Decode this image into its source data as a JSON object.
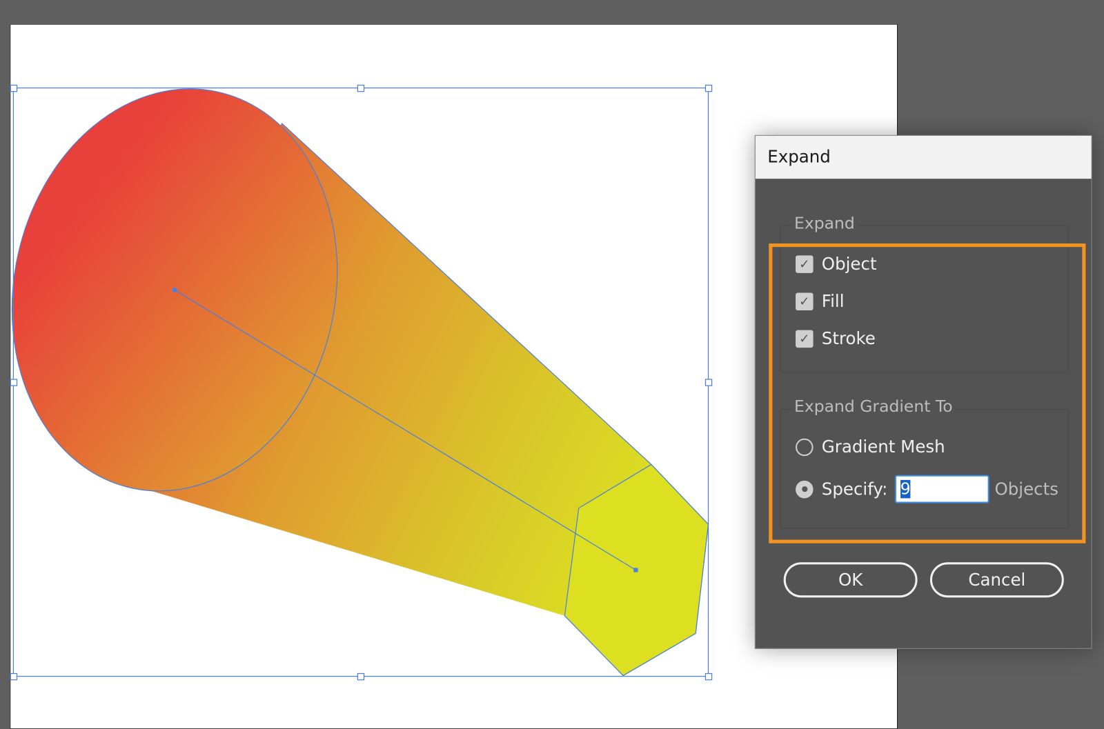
{
  "dialog": {
    "title": "Expand",
    "expand_group": {
      "label": "Expand",
      "options": [
        {
          "label": "Object",
          "checked": true
        },
        {
          "label": "Fill",
          "checked": true
        },
        {
          "label": "Stroke",
          "checked": true
        }
      ]
    },
    "gradient_group": {
      "label": "Expand Gradient To",
      "gradient_mesh_label": "Gradient Mesh",
      "specify_label": "Specify:",
      "specify_value": "9",
      "objects_label": "Objects",
      "selected": "Specify"
    },
    "ok_label": "OK",
    "cancel_label": "Cancel"
  },
  "colors": {
    "gradient_start": "#e8403a",
    "gradient_end": "#dde020",
    "selection": "#4a7fe0",
    "highlight": "#f39322"
  }
}
